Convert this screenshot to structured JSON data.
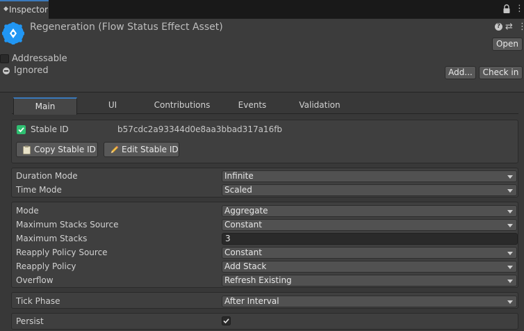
{
  "window_tab": {
    "label": "Inspector"
  },
  "header": {
    "title": "Regeneration (Flow Status Effect Asset)",
    "open_label": "Open",
    "addressable_label": "Addressable",
    "ignored_label": "Ignored",
    "add_label": "Add...",
    "checkin_label": "Check in"
  },
  "tabs": [
    "Main",
    "UI",
    "Contributions",
    "Events",
    "Validation"
  ],
  "stable_id": {
    "label": "Stable ID",
    "value": "b57cdc2a93344d0e8aa3bbad317a16fb",
    "copy_label": "Copy Stable ID",
    "edit_label": "Edit Stable ID"
  },
  "timing": {
    "duration_mode_label": "Duration Mode",
    "duration_mode_value": "Infinite",
    "time_mode_label": "Time Mode",
    "time_mode_value": "Scaled"
  },
  "stacking": {
    "mode_label": "Mode",
    "mode_value": "Aggregate",
    "max_stacks_source_label": "Maximum Stacks Source",
    "max_stacks_source_value": "Constant",
    "max_stacks_label": "Maximum Stacks",
    "max_stacks_value": "3",
    "reapply_source_label": "Reapply Policy Source",
    "reapply_source_value": "Constant",
    "reapply_label": "Reapply Policy",
    "reapply_value": "Add Stack",
    "overflow_label": "Overflow",
    "overflow_value": "Refresh Existing"
  },
  "tick": {
    "tick_phase_label": "Tick Phase",
    "tick_phase_value": "After Interval"
  },
  "persist": {
    "label": "Persist",
    "checked": true
  },
  "colors": {
    "accent": "#3a79bb",
    "check_green": "#2fbf71",
    "asset_icon_blue": "#2196f3"
  }
}
